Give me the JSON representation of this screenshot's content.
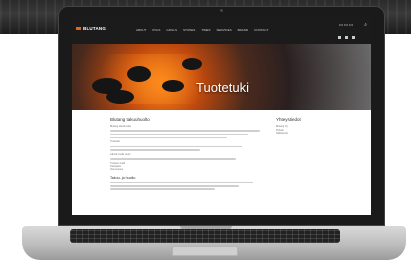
{
  "site": {
    "logo_text": "BLUTANG",
    "menu": [
      "ABOUT",
      "POLS",
      "GRILLS",
      "STONES",
      "TIMES",
      "SERVICES",
      "BRAND",
      "CONTACT"
    ],
    "top_right_info": "0 0 0 0 0 0",
    "search_icon": "search-icon"
  },
  "hero": {
    "title": "Tuotetuki"
  },
  "content": {
    "left_heading": "Blutang takuuhuolto",
    "paragraphs": [
      "Blutang takuuhuolto",
      "Tuotetuki",
      "Lähetä meille viesti"
    ],
    "bullets": [
      "Tuotteen malli",
      "Ostopäivä",
      "Vian kuvaus"
    ],
    "subheading": "Takuu- ja huolto",
    "right_heading": "Yhteystiedot",
    "contact_lines": [
      "Blutang Oy",
      "Puhelin",
      "Sähköposti"
    ]
  },
  "colors": {
    "accent": "#e2671d",
    "nav_bg": "#1b1b1b"
  }
}
